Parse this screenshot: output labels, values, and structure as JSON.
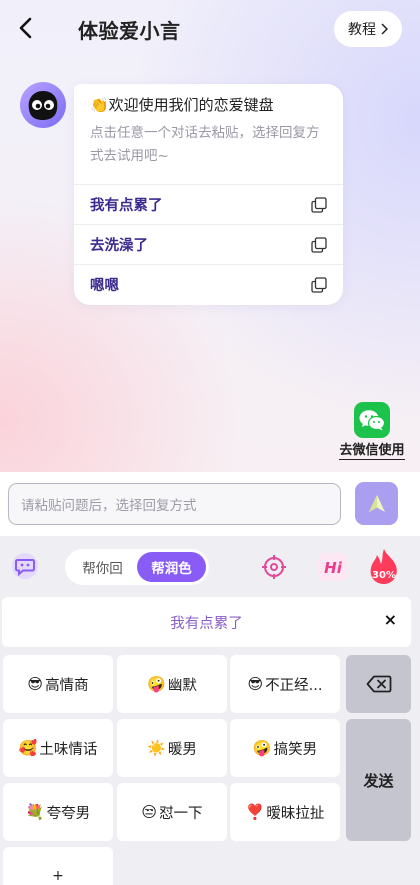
{
  "header": {
    "back_icon": "chevron-left-icon",
    "title": "体验爱小言",
    "tutorial_label": "教程",
    "tutorial_icon": "chevron-right-icon"
  },
  "chat": {
    "avatar_icon": "black-blob-mascot-icon",
    "greeting": "👏欢迎使用我们的恋爱键盘",
    "description": "点击任意一个对话去粘贴，选择回复方式去试用吧~",
    "replies": [
      {
        "label": "我有点累了",
        "icon": "copy-icon"
      },
      {
        "label": "去洗澡了",
        "icon": "copy-icon"
      },
      {
        "label": "嗯嗯",
        "icon": "copy-icon"
      }
    ]
  },
  "wechat": {
    "icon": "wechat-icon",
    "label": "去微信使用"
  },
  "input": {
    "placeholder": "请粘贴问题后，选择回复方式",
    "send_icon": "paper-plane-icon"
  },
  "keyboard": {
    "mode_left_icon": "chat-bubble-icon",
    "modes": [
      {
        "label": "帮你回",
        "active": false
      },
      {
        "label": "帮润色",
        "active": true
      }
    ],
    "tools": [
      {
        "icon": "target-icon"
      },
      {
        "icon": "hi-icon",
        "text": "Hi"
      },
      {
        "icon": "flame-icon",
        "text": "30%"
      }
    ],
    "selected_text": "我有点累了",
    "close_label": "×",
    "styles": [
      {
        "emoji": "😎",
        "label": "高情商"
      },
      {
        "emoji": "🤪",
        "label": "幽默"
      },
      {
        "emoji": "😎",
        "label": "不正经..."
      },
      {
        "emoji": "🥰",
        "label": "土味情话"
      },
      {
        "emoji": "☀️",
        "label": "暖男"
      },
      {
        "emoji": "🤪",
        "label": "搞笑男"
      },
      {
        "emoji": "💐",
        "label": "夸夸男"
      },
      {
        "emoji": "😒",
        "label": "怼一下"
      },
      {
        "emoji": "❣️",
        "label": "暧昧拉扯"
      }
    ],
    "add_label": "+",
    "delete_icon": "backspace-icon",
    "send_label": "发送",
    "colors": {
      "accent": "#8a5cf6",
      "wechat": "#1dc24b",
      "send_button": "#a99ef0",
      "flame": "#ff3b5c"
    }
  }
}
